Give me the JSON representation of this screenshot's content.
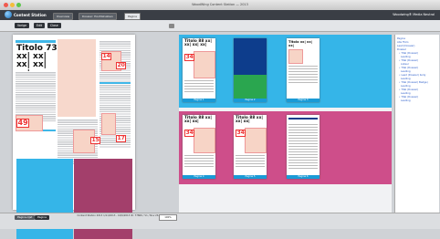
{
  "window": {
    "title": "WoodWing Content Station — 2013"
  },
  "app": {
    "name": "Content Station"
  },
  "tabs": [
    "Overview",
    "Dossier: Hoofdstukken",
    "Pagina"
  ],
  "brand": "Woodwing® Media Neutral",
  "toolbar": {
    "buttons": [
      "Vorige",
      "Edit",
      "Close"
    ]
  },
  "preview": {
    "headline": "Titolo 73 xx| xx| xx| xx| xx|",
    "numbers": [
      "49",
      "14",
      "17",
      "20",
      "15"
    ]
  },
  "spreads": [
    {
      "label": "Pagina 1",
      "headline": "Titolo 88 xx| xx| xx| xx|",
      "num": "34"
    },
    {
      "label": "Pagina 2"
    },
    {
      "label": "Pagina 3",
      "headline": "Titolo xx| xx| xx|",
      "num": ""
    },
    {
      "label": "Pagina 4",
      "headline": "Titolo 88 xx| xx| xx|",
      "num": "34"
    },
    {
      "label": "Pagina 5",
      "headline": "Titolo 88 xx| xx| xx|",
      "num": "34"
    },
    {
      "label": "Pagina 6"
    }
  ],
  "tree": {
    "items": [
      "Pagina",
      "Alle Ttolo",
      "Lead (Dossier)",
      "Dossier",
      "• Titel (Dossier)",
      "Leading",
      "• Titel (Dossier)",
      "Auteur",
      "• Titel (Dossier)",
      "Leading",
      "• Lead (Dossier) body",
      "Leading",
      "• Titel (Dossier) Badge)",
      "Leading",
      "• Titel (Dossier)",
      "Leading",
      "• Titel (Dossier)",
      "Leading"
    ]
  },
  "status": {
    "left_buttons": [
      "Pagina-lijst",
      "Pagina"
    ],
    "text": "Content Station 2013 1/11/2013 - 10/6/2013 ID: 77869 / V1 / Nov 26",
    "zoom": "100%"
  },
  "colors": {
    "cyan": "#35b5e8",
    "magenta": "#ce4e8a",
    "plum": "#a33f6b",
    "navy": "#0d3d8c",
    "green": "#2aa64f"
  }
}
